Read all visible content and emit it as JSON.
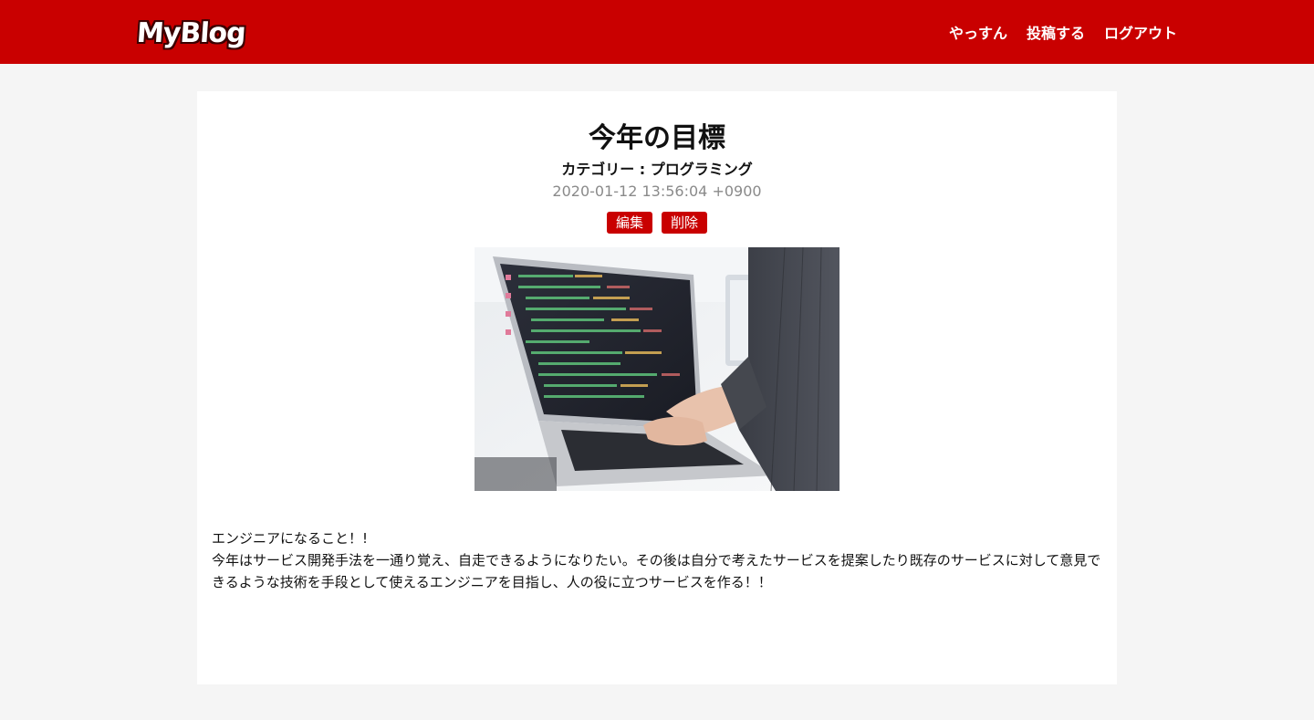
{
  "header": {
    "logo_text": "MyBlog",
    "nav": [
      {
        "label": "やっすん"
      },
      {
        "label": "投稿する"
      },
      {
        "label": "ログアウト"
      }
    ],
    "brand_color": "#c90000"
  },
  "post": {
    "title": "今年の目標",
    "category": "カテゴリー : プログラミング",
    "timestamp": "2020-01-12 13:56:04 +0900",
    "edit_label": "編集",
    "delete_label": "削除",
    "image_subject": "laptop-coding-photo",
    "body_line1": "エンジニアになること！!",
    "body_line2": "今年はサービス開発手法を一通り覚え、自走できるようになりたい。その後は自分で考えたサービスを提案したり既存のサービスに対して意見できるような技術を手段として使えるエンジニアを目指し、人の役に立つサービスを作る！！"
  }
}
